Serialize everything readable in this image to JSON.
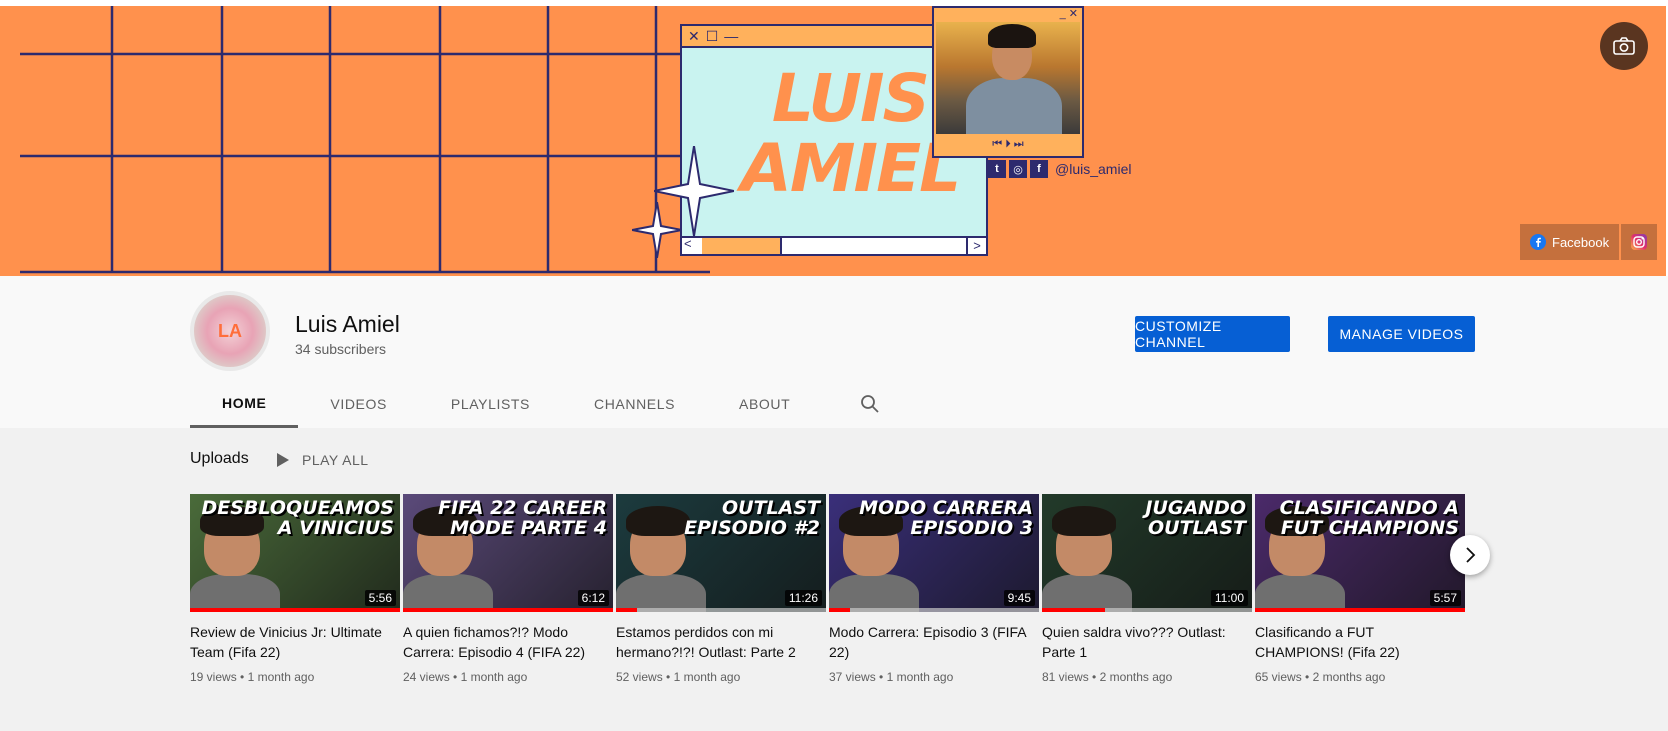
{
  "banner": {
    "title_line1": "LUIS",
    "title_line2": "AMIEL",
    "handle": "@luis_amiel",
    "facebook_label": "Facebook",
    "colors": {
      "background": "#ff914d",
      "grid": "#2d2a6e",
      "window": "#c9f3f0",
      "accent": "#ffb15c"
    }
  },
  "channel": {
    "avatar_initials": "LA",
    "name": "Luis Amiel",
    "subscribers": "34 subscribers",
    "customize_label": "CUSTOMIZE CHANNEL",
    "manage_label": "MANAGE VIDEOS",
    "accent_color": "#065fd4"
  },
  "tabs": [
    "HOME",
    "VIDEOS",
    "PLAYLISTS",
    "CHANNELS",
    "ABOUT"
  ],
  "active_tab": "HOME",
  "shelf": {
    "title": "Uploads",
    "play_all": "PLAY ALL",
    "videos": [
      {
        "title": "Review de Vinicius Jr: Ultimate Team (Fifa 22)",
        "views": "19 views",
        "age": "1 month ago",
        "duration": "5:56",
        "thumb_text": "DESBLOQUEAMOS A VINICIUS",
        "progress": 1.0,
        "bg": "#4a6b3a"
      },
      {
        "title": "A quien fichamos?!? Modo Carrera: Episodio 4 (FIFA 22)",
        "views": "24 views",
        "age": "1 month ago",
        "duration": "6:12",
        "thumb_text": "FIFA 22 CAREER MODE PARTE 4",
        "progress": 1.0,
        "bg": "#5b4a7a"
      },
      {
        "title": "Estamos perdidos con mi hermano?!?! Outlast: Parte 2",
        "views": "52 views",
        "age": "1 month ago",
        "duration": "11:26",
        "thumb_text": "OUTLAST EPISODIO #2",
        "progress": 0.1,
        "bg": "#1c3b3e"
      },
      {
        "title": "Modo Carrera: Episodio 3 (FIFA 22)",
        "views": "37 views",
        "age": "1 month ago",
        "duration": "9:45",
        "thumb_text": "MODO CARRERA EPISODIO 3",
        "progress": 0.1,
        "bg": "#3a2f7a"
      },
      {
        "title": "Quien saldra vivo??? Outlast: Parte 1",
        "views": "81 views",
        "age": "2 months ago",
        "duration": "11:00",
        "thumb_text": "JUGANDO OUTLAST",
        "progress": 0.3,
        "bg": "#223a2a"
      },
      {
        "title": "Clasificando a FUT CHAMPIONS! (Fifa 22)",
        "views": "65 views",
        "age": "2 months ago",
        "duration": "5:57",
        "thumb_text": "CLASIFICANDO A FUT CHAMPIONS",
        "progress": 1.0,
        "bg": "#4b2a6a"
      }
    ]
  },
  "icons": {
    "camera": "camera-icon",
    "search": "search-icon",
    "play": "play-icon",
    "next": "chevron-right-icon",
    "facebook": "facebook-icon",
    "instagram": "instagram-icon",
    "twitter": "twitter-icon"
  }
}
